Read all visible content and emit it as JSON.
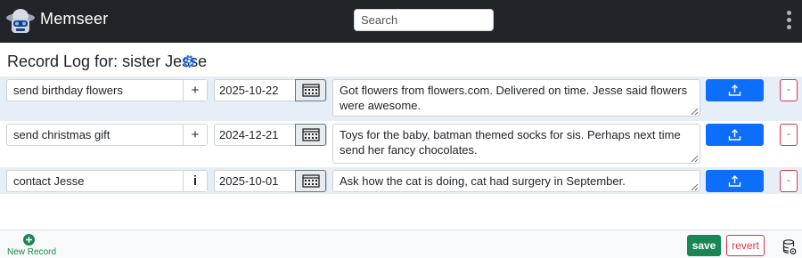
{
  "app": {
    "title": "Memseer"
  },
  "search": {
    "placeholder": "Search"
  },
  "page": {
    "title": "Record Log for: sister Jesse"
  },
  "records": [
    {
      "name": "send birthday flowers",
      "action_glyph": "+",
      "date": "2025-10-22",
      "note": "Got flowers from flowers.com. Delivered on time. Jesse said flowers were awesome.",
      "remove_label": "-"
    },
    {
      "name": "send christmas gift",
      "action_glyph": "+",
      "date": "2024-12-21",
      "note": "Toys for the baby, batman themed socks for sis. Perhaps next time send her fancy chocolates.",
      "remove_label": "-"
    },
    {
      "name": "contact Jesse",
      "action_glyph": "i",
      "date": "2025-10-01",
      "note": "Ask how the cat is doing, cat had surgery in September.",
      "remove_label": "-"
    }
  ],
  "footer": {
    "new_record_label": "New Record",
    "save_label": "save",
    "revert_label": "revert"
  },
  "icons": {
    "logo": "robot-logo-icon",
    "menu": "kebab-menu-icon",
    "settings": "gear-icon",
    "calendar": "calendar-icon",
    "upload": "upload-icon",
    "add": "plus-circle-icon",
    "database": "database-gear-icon"
  },
  "colors": {
    "navbar": "#212529",
    "primary": "#0d6efd",
    "success": "#198754",
    "danger": "#dc3545",
    "row_highlight": "#e6eef7"
  }
}
